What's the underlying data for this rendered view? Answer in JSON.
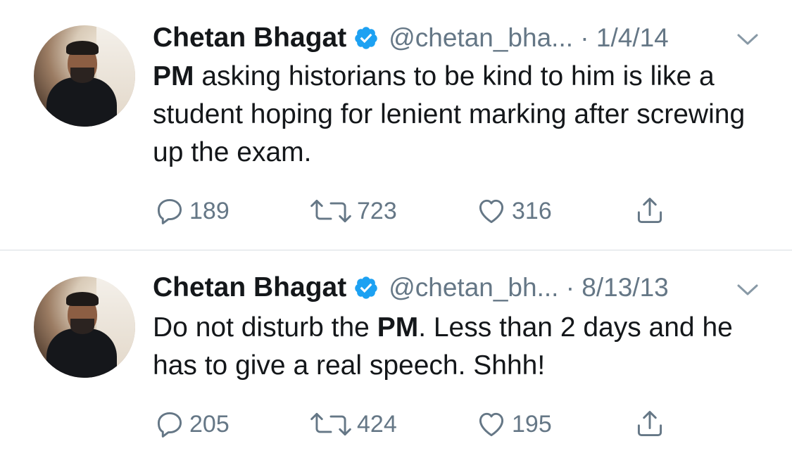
{
  "tweets": [
    {
      "name": "Chetan Bhagat",
      "handle_date": "@chetan_bha... · 1/4/14",
      "text_bold": "PM",
      "text_rest": " asking historians to be kind to him is like a student hoping for lenient marking after screwing up the exam.",
      "replies": "189",
      "retweets": "723",
      "likes": "316"
    },
    {
      "name": "Chetan Bhagat",
      "handle_date": "@chetan_bh... · 8/13/13",
      "text_before": "Do not disturb the ",
      "text_bold": "PM",
      "text_after": ". Less than 2 days and he has to give a real speech. Shhh!",
      "replies": "205",
      "retweets": "424",
      "likes": "195"
    }
  ],
  "colors": {
    "text": "#14171a",
    "secondary": "#657786",
    "verified": "#1da1f2",
    "divider": "#d8dde1"
  },
  "icons": [
    "verified-badge-icon",
    "chevron-down-icon",
    "reply-icon",
    "retweet-icon",
    "like-icon",
    "share-icon"
  ]
}
